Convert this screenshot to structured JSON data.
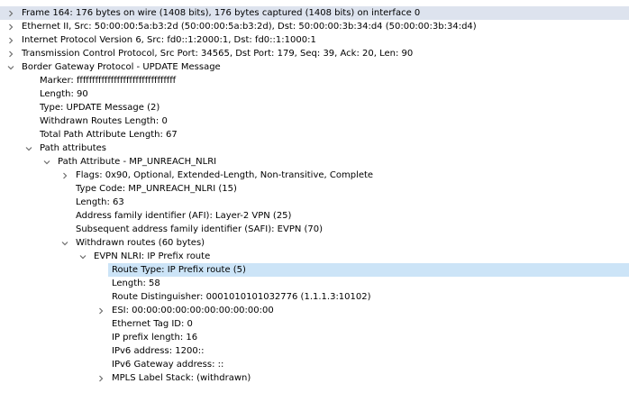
{
  "tree": {
    "rows": [
      {
        "label": "Frame 164: 176 bytes on wire (1408 bits), 176 bytes captured (1408 bits) on interface 0",
        "twisty": "collapsed"
      },
      {
        "label": "Ethernet II, Src: 50:00:00:5a:b3:2d (50:00:00:5a:b3:2d), Dst: 50:00:00:3b:34:d4 (50:00:00:3b:34:d4)",
        "twisty": "collapsed"
      },
      {
        "label": "Internet Protocol Version 6, Src: fd0::1:2000:1, Dst: fd0::1:1000:1",
        "twisty": "collapsed"
      },
      {
        "label": "Transmission Control Protocol, Src Port: 34565, Dst Port: 179, Seq: 39, Ack: 20, Len: 90",
        "twisty": "collapsed"
      },
      {
        "label": "Border Gateway Protocol - UPDATE Message",
        "twisty": "expanded"
      },
      {
        "label": "Marker: ffffffffffffffffffffffffffffffff",
        "twisty": "none"
      },
      {
        "label": "Length: 90",
        "twisty": "none"
      },
      {
        "label": "Type: UPDATE Message (2)",
        "twisty": "none"
      },
      {
        "label": "Withdrawn Routes Length: 0",
        "twisty": "none"
      },
      {
        "label": "Total Path Attribute Length: 67",
        "twisty": "none"
      },
      {
        "label": "Path attributes",
        "twisty": "expanded"
      },
      {
        "label": "Path Attribute - MP_UNREACH_NLRI",
        "twisty": "expanded"
      },
      {
        "label": "Flags: 0x90, Optional, Extended-Length, Non-transitive, Complete",
        "twisty": "collapsed"
      },
      {
        "label": "Type Code: MP_UNREACH_NLRI (15)",
        "twisty": "none"
      },
      {
        "label": "Length: 63",
        "twisty": "none"
      },
      {
        "label": "Address family identifier (AFI): Layer-2 VPN (25)",
        "twisty": "none"
      },
      {
        "label": "Subsequent address family identifier (SAFI): EVPN (70)",
        "twisty": "none"
      },
      {
        "label": "Withdrawn routes (60 bytes)",
        "twisty": "expanded"
      },
      {
        "label": "EVPN NLRI: IP Prefix route",
        "twisty": "expanded"
      },
      {
        "label": "Route Type: IP Prefix route (5)",
        "twisty": "none"
      },
      {
        "label": "Length: 58",
        "twisty": "none"
      },
      {
        "label": "Route Distinguisher: 0001010101032776 (1.1.1.3:10102)",
        "twisty": "none"
      },
      {
        "label": "ESI: 00:00:00:00:00:00:00:00:00:00",
        "twisty": "collapsed"
      },
      {
        "label": "Ethernet Tag ID: 0",
        "twisty": "none"
      },
      {
        "label": "IP prefix length: 16",
        "twisty": "none"
      },
      {
        "label": "IPv6 address: 1200::",
        "twisty": "none"
      },
      {
        "label": "IPv6 Gateway address: ::",
        "twisty": "none"
      },
      {
        "label": "MPLS Label Stack:  (withdrawn)",
        "twisty": "collapsed"
      }
    ]
  },
  "colors": {
    "frame_row_highlight": "#dde3ee",
    "selected_row": "#cce4f7",
    "twisty": "#6e6e6e"
  }
}
